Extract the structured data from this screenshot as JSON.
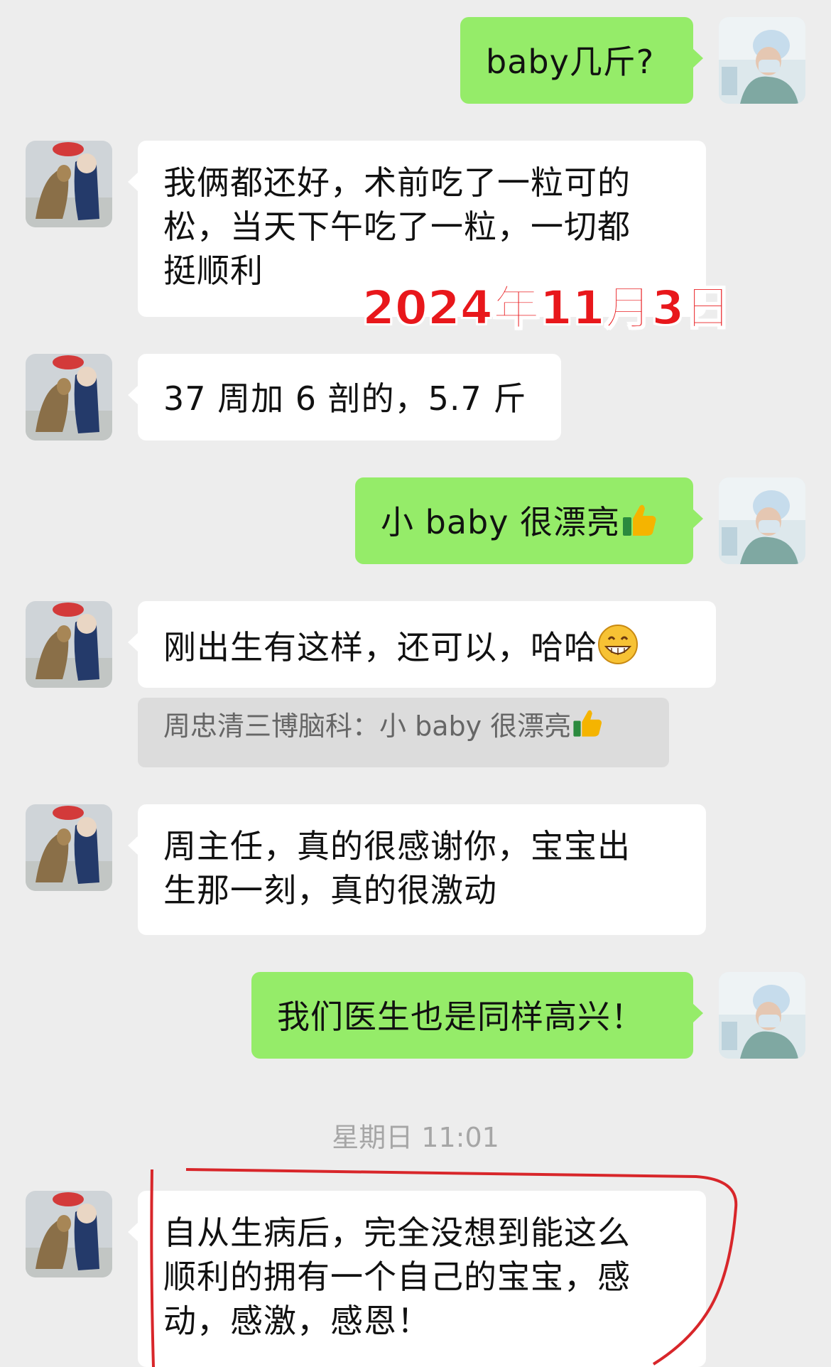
{
  "messages": [
    {
      "id": "m1",
      "side": "out",
      "text": "baby几斤?"
    },
    {
      "id": "m2",
      "side": "in",
      "lines": [
        "我俩都还好，术前吃了一粒可的",
        "松，当天下午吃了一粒，一切都",
        "挺顺利"
      ]
    },
    {
      "id": "m3",
      "side": "in",
      "text": "37 周加 6 剖的，5.7 斤"
    },
    {
      "id": "m4",
      "side": "out",
      "text": "小 baby 很漂亮",
      "emoji": "thumbs-up"
    },
    {
      "id": "m5",
      "side": "in",
      "text": "刚出生有这样，还可以，哈哈",
      "emoji": "grin"
    },
    {
      "id": "m6",
      "side": "in",
      "lines": [
        "周主任，真的很感谢你，宝宝出",
        "生那一刻，真的很激动"
      ]
    },
    {
      "id": "m7",
      "side": "out",
      "text": "我们医生也是同样高兴！"
    },
    {
      "id": "m8",
      "side": "in",
      "lines": [
        "自从生病后，完全没想到能这么",
        "顺利的拥有一个自己的宝宝，感",
        "动，感激，感恩！"
      ]
    }
  ],
  "quote": {
    "text": "周忠清三博脑科：小 baby 很漂亮",
    "emoji": "thumbs-up"
  },
  "timestamp": "星期日 11:01",
  "date_overlay": "2024年11月3日",
  "colors": {
    "background": "#ededed",
    "out_bubble": "#95ec69",
    "in_bubble": "#ffffff",
    "overlay_red": "#e8171b",
    "highlight_red": "#d8262a"
  }
}
